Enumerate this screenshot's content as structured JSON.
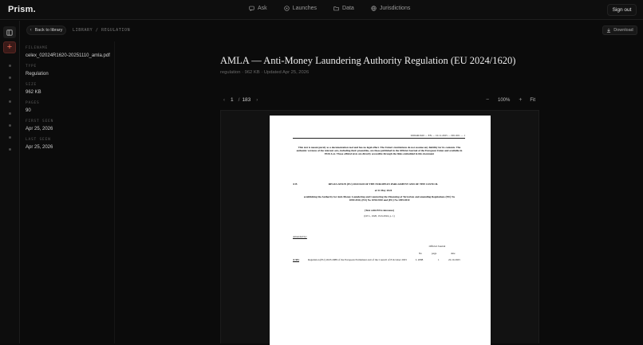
{
  "topbar": {
    "brand": "Prism.",
    "nav": [
      {
        "label": "Ask",
        "icon": "chat-icon"
      },
      {
        "label": "Launches",
        "icon": "rocket-icon"
      },
      {
        "label": "Data",
        "icon": "folder-icon"
      },
      {
        "label": "Jurisdictions",
        "icon": "globe-icon"
      }
    ],
    "signout": "Sign out"
  },
  "breadcrumb": {
    "back": "Back to library",
    "path": "LIBRARY / REGULATION",
    "download": "Download"
  },
  "meta": [
    {
      "label": "FILENAME",
      "value": "celex_02024R1620-20251110_amla.pdf"
    },
    {
      "label": "TYPE",
      "value": "Regulation"
    },
    {
      "label": "SIZE",
      "value": "962 KB"
    },
    {
      "label": "PAGES",
      "value": "90"
    },
    {
      "label": "FIRST SEEN",
      "value": "Apr 25, 2026"
    },
    {
      "label": "LAST SEEN",
      "value": "Apr 25, 2026"
    }
  ],
  "document": {
    "title": "AMLA — Anti-Money Laundering Authority Regulation (EU 2024/1620)",
    "subtitle": "regulation · 962 KB · Updated Apr 25, 2026"
  },
  "pager": {
    "current": "1",
    "sep": "/",
    "total": "183"
  },
  "zoom": {
    "minus": "−",
    "level": "100%",
    "plus": "+",
    "fit": "Fit"
  },
  "pdf": {
    "header": "02024R1620 — EN — 10.11.2025 — 001.001 — 1",
    "disclaimer": "This text is meant purely as a documentation tool and has no legal effect. The Union's institutions do not assume any liability for its contents. The authentic versions of the relevant acts, including their preambles, are those published in the Official Journal of the European Union and available in EUR-Lex. Those official texts are directly accessible through the links embedded in this document",
    "marker": "►B",
    "reg_title": "REGULATION (EU) 2024/1620 OF THE EUROPEAN PARLIAMENT AND OF THE COUNCIL",
    "date": "of 31 May 2024",
    "establishing": "establishing the Authority for Anti-Money Laundering and Countering the Financing of Terrorism and amending Regulations (EU) No 1093/2010, (EU) No 1094/2010 and (EU) No 1095/2010",
    "eea": "(Text with EEA relevance)",
    "oj": "(OJ L, 1620, 19.6.2024, p. 1)",
    "amended": "Amended by:",
    "oj_head": "Official Journal",
    "col_no": "No",
    "col_page": "page",
    "col_date": "date",
    "row_marker": "►M1",
    "row_text": "Regulation (EU) 2025/2088 of the European Parliament and of the Council of 8 October 2025",
    "row_no": "L 2088",
    "row_page": "1",
    "row_date": "22.10.2025"
  }
}
